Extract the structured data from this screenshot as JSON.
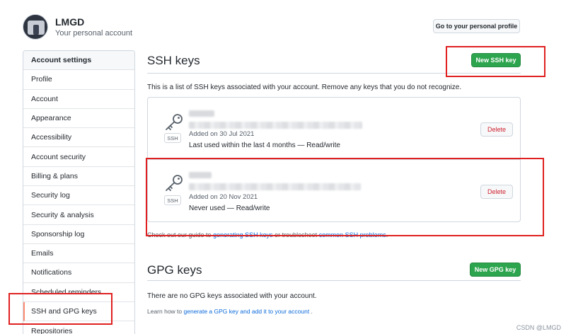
{
  "user": {
    "name": "LMGD",
    "subtitle": "Your personal account",
    "profile_button": "Go to your personal profile"
  },
  "sidebar": {
    "items": [
      {
        "label": "Account settings"
      },
      {
        "label": "Profile"
      },
      {
        "label": "Account"
      },
      {
        "label": "Appearance"
      },
      {
        "label": "Accessibility"
      },
      {
        "label": "Account security"
      },
      {
        "label": "Billing & plans"
      },
      {
        "label": "Security log"
      },
      {
        "label": "Security & analysis"
      },
      {
        "label": "Sponsorship log"
      },
      {
        "label": "Emails"
      },
      {
        "label": "Notifications"
      },
      {
        "label": "Scheduled reminders"
      },
      {
        "label": "SSH and GPG keys"
      },
      {
        "label": "Repositories"
      }
    ]
  },
  "ssh": {
    "title": "SSH keys",
    "new_button": "New SSH key",
    "intro": "This is a list of SSH keys associated with your account. Remove any keys that you do not recognize.",
    "badge": "SSH",
    "delete_label": "Delete",
    "keys": [
      {
        "added": "Added on 30 Jul 2021",
        "usage": "Last used within the last 4 months — Read/write"
      },
      {
        "added": "Added on 20 Nov 2021",
        "usage": "Never used — Read/write"
      }
    ],
    "guide_prefix": "Check out our guide to ",
    "guide_link1": "generating SSH keys",
    "guide_mid": " or troubleshoot ",
    "guide_link2": "common SSH problems",
    "guide_suffix": "."
  },
  "gpg": {
    "title": "GPG keys",
    "new_button": "New GPG key",
    "none_text": "There are no GPG keys associated with your account.",
    "learn_prefix": "Learn how to ",
    "learn_link": "generate a GPG key and add it to your account",
    "learn_suffix": " ."
  },
  "watermark": "CSDN @LMGD",
  "colors": {
    "primary_green": "#2da44e",
    "danger_red": "#cf222e",
    "link_blue": "#0969da",
    "annotation_red": "#e02020",
    "active_marker": "#fd8c73"
  }
}
